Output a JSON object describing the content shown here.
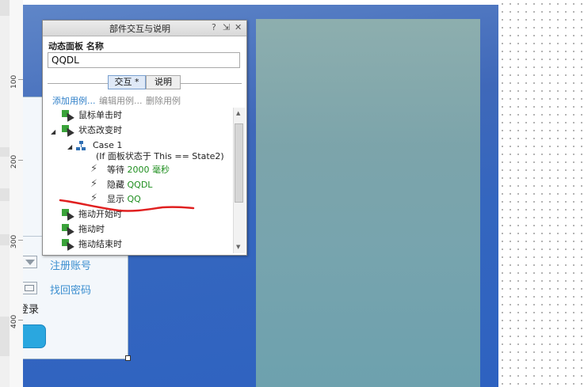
{
  "ruler": {
    "labels": [
      "100",
      "200",
      "300",
      "400"
    ]
  },
  "login_panel": {
    "register_link": "注册账号",
    "recover_link": "找回密码",
    "login_text": "登录"
  },
  "dialog": {
    "title": "部件交互与说明",
    "help": "?",
    "dock": "⇲",
    "close": "✕",
    "name_label": "动态面板 名称",
    "name_value": "QQDL",
    "tabs": [
      "交互 *",
      "说明"
    ],
    "actions": [
      "添加用例...",
      "编辑用例...",
      "删除用例"
    ],
    "tree": {
      "click_event": "鼠标单击时",
      "state_change_event": "状态改变时",
      "case_name": "Case 1",
      "case_condition": "(If 面板状态于 This == State2)",
      "step_wait": "等待",
      "step_wait_value": "2000 毫秒",
      "step_hide": "隐藏",
      "step_hide_value": "QQDL",
      "step_show": "显示",
      "step_show_value": "QQ",
      "drag_start_event": "拖动开始时",
      "drag_event": "拖动时",
      "drag_end_event": "拖动结束时"
    }
  },
  "colors": {
    "canvas_blue": "#3466bf",
    "link_blue": "#3c8fd0",
    "green_text": "#1e8e1e",
    "annotation_red": "#e02020",
    "login_button": "#2aa7df"
  }
}
